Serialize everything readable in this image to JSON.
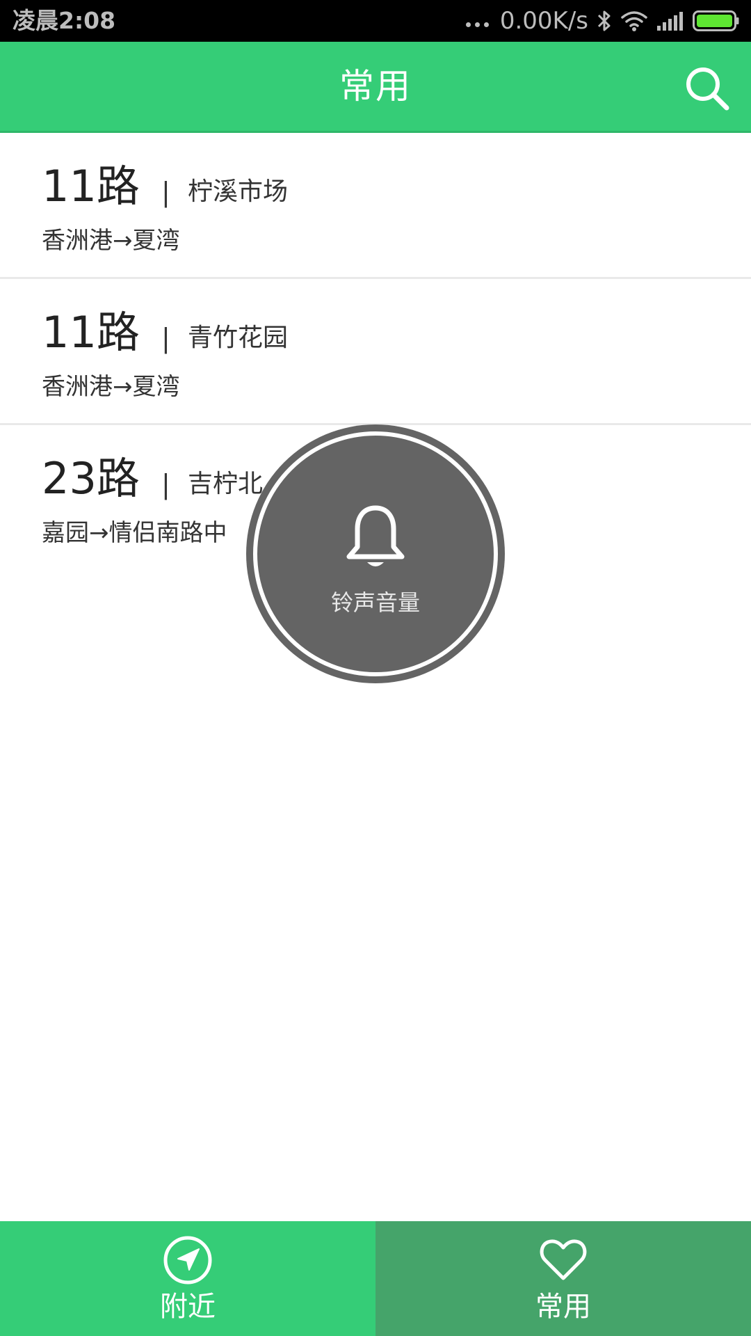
{
  "status_bar": {
    "time": "凌晨2:08",
    "net_speed": "0.00K/s",
    "icons": [
      "more-dots-icon",
      "bluetooth-icon",
      "wifi-icon",
      "signal-icon",
      "battery-icon"
    ],
    "battery_color": "#5ee632"
  },
  "app_bar": {
    "title": "常用",
    "search_icon": "search-icon",
    "background": "#35cd77"
  },
  "routes": [
    {
      "line": "11路",
      "separator": "|",
      "stop": "柠溪市场",
      "direction": "香洲港→夏湾"
    },
    {
      "line": "11路",
      "separator": "|",
      "stop": "青竹花园",
      "direction": "香洲港→夏湾"
    },
    {
      "line": "23路",
      "separator": "|",
      "stop": "吉柠北",
      "direction": "嘉园→情侣南路中"
    }
  ],
  "volume_overlay": {
    "label": "铃声音量",
    "icon": "bell-icon"
  },
  "bottom_nav": {
    "tabs": [
      {
        "label": "附近",
        "icon": "navigation-arrow-icon",
        "selected": false
      },
      {
        "label": "常用",
        "icon": "heart-icon",
        "selected": true
      }
    ],
    "color_default": "#35cd77",
    "color_selected": "#45a46a"
  }
}
